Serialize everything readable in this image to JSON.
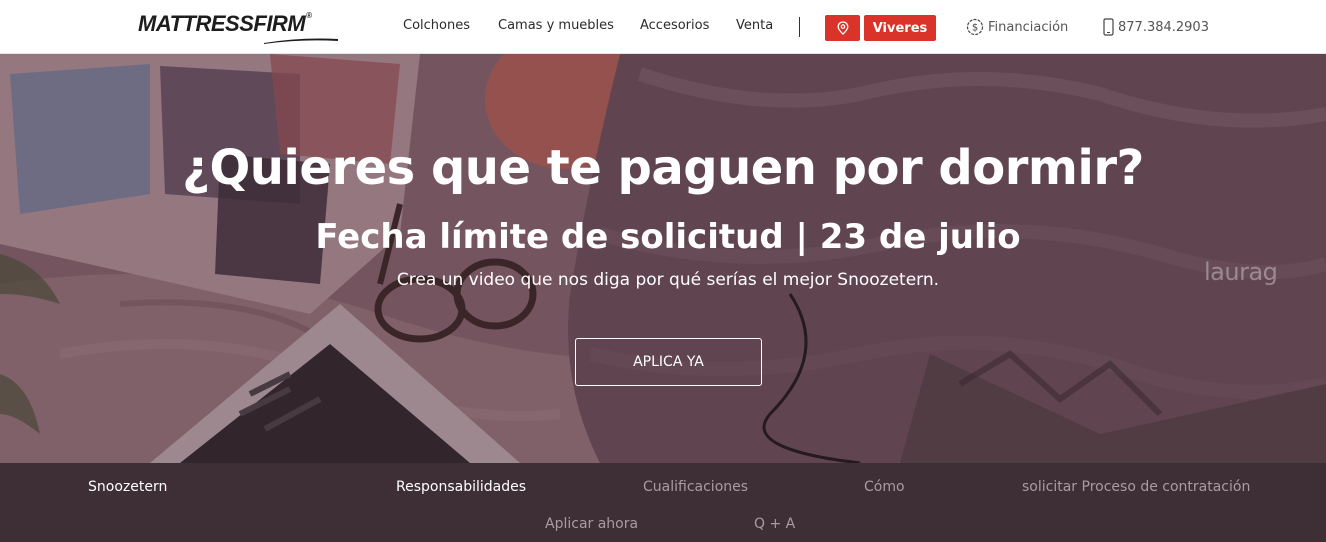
{
  "header": {
    "logo": {
      "part1": "MATTRESS",
      "part2": "FIRM",
      "reg": "®"
    },
    "nav": [
      "Colchones",
      "Camas y muebles",
      "Accesorios",
      "Venta"
    ],
    "stores_button": "Viveres",
    "financing": "Financiación",
    "phone": "877.384.2903"
  },
  "hero": {
    "title": "¿Quieres que te paguen por dormir?",
    "subtitle": "Fecha límite de solicitud | 23 de julio",
    "description": "Crea un video que nos diga por qué serías el mejor Snoozetern.",
    "cta": "APLICA YA",
    "watermark": "laurag"
  },
  "subnav": {
    "items": [
      "Snoozetern",
      "Responsabilidades",
      "Cualificaciones",
      "Cómo",
      "solicitar Proceso de contratación",
      "Aplicar ahora",
      "Q + A"
    ]
  },
  "colors": {
    "accent": "#d9332a",
    "subnav_bg": "#3e2e35",
    "text_dark": "#2b2b2b"
  }
}
